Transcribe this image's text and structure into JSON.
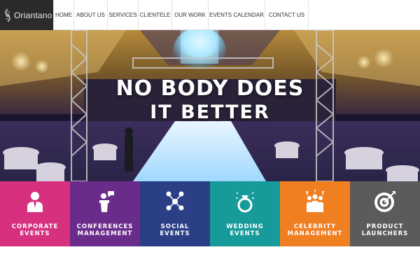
{
  "brand": {
    "name": "Oriantano"
  },
  "nav": {
    "items": [
      {
        "label": "HOME"
      },
      {
        "label": "ABOUT US"
      },
      {
        "label": "SERVICES"
      },
      {
        "label": "CLIENTELE"
      },
      {
        "label": "OUR WORK"
      },
      {
        "label": "EVENTS CALENDAR"
      },
      {
        "label": "CONTACT US"
      }
    ]
  },
  "hero": {
    "line1": "NO BODY DOES",
    "line2": "IT BETTER"
  },
  "tiles": [
    {
      "line1": "CORPORATE",
      "line2": "EVENTS",
      "color": "#d6307f",
      "icon": "businessman-icon"
    },
    {
      "line1": "CONFERENCES",
      "line2": "MANAGEMENT",
      "color": "#6a2c8a",
      "icon": "podium-speaker-icon"
    },
    {
      "line1": "SOCIAL",
      "line2": "EVENTS",
      "color": "#2b3f86",
      "icon": "social-network-icon"
    },
    {
      "line1": "WEDDING",
      "line2": "EVENTS",
      "color": "#179a9a",
      "icon": "wedding-ring-icon"
    },
    {
      "line1": "CELEBRITY",
      "line2": "MANAGEMENT",
      "color": "#f07f21",
      "icon": "crowd-cheering-icon"
    },
    {
      "line1": "PRODUCT",
      "line2": "LAUNCHERS",
      "color": "#5b5b5b",
      "icon": "target-arrow-icon"
    }
  ]
}
